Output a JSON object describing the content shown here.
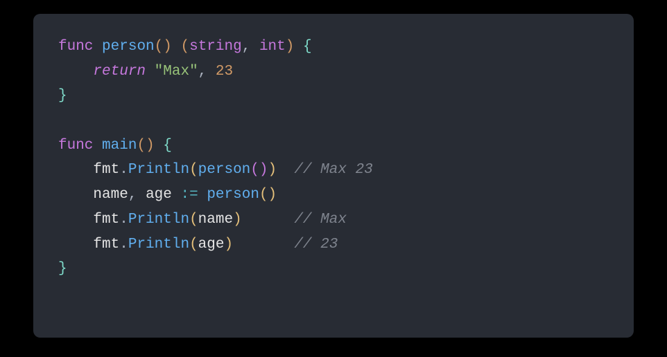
{
  "tokens": {
    "func": "func",
    "return": "return",
    "person": "person",
    "main": "main",
    "fmt": "fmt",
    "Println": "Println",
    "string_type": "string",
    "int_type": "int",
    "string_max": "\"Max\"",
    "num_23": "23",
    "name": "name",
    "age": "age",
    "assign": ":=",
    "comma": ",",
    "comma_space": ", ",
    "dot": ".",
    "lparen": "(",
    "rparen": ")",
    "lbrace": "{",
    "rbrace": "}",
    "space": " ",
    "indent": "    ",
    "comment_max_23": "// Max 23",
    "comment_max": "// Max",
    "comment_23": "// 23",
    "spacer1": "  ",
    "spacer2": "      ",
    "spacer3": "       "
  }
}
